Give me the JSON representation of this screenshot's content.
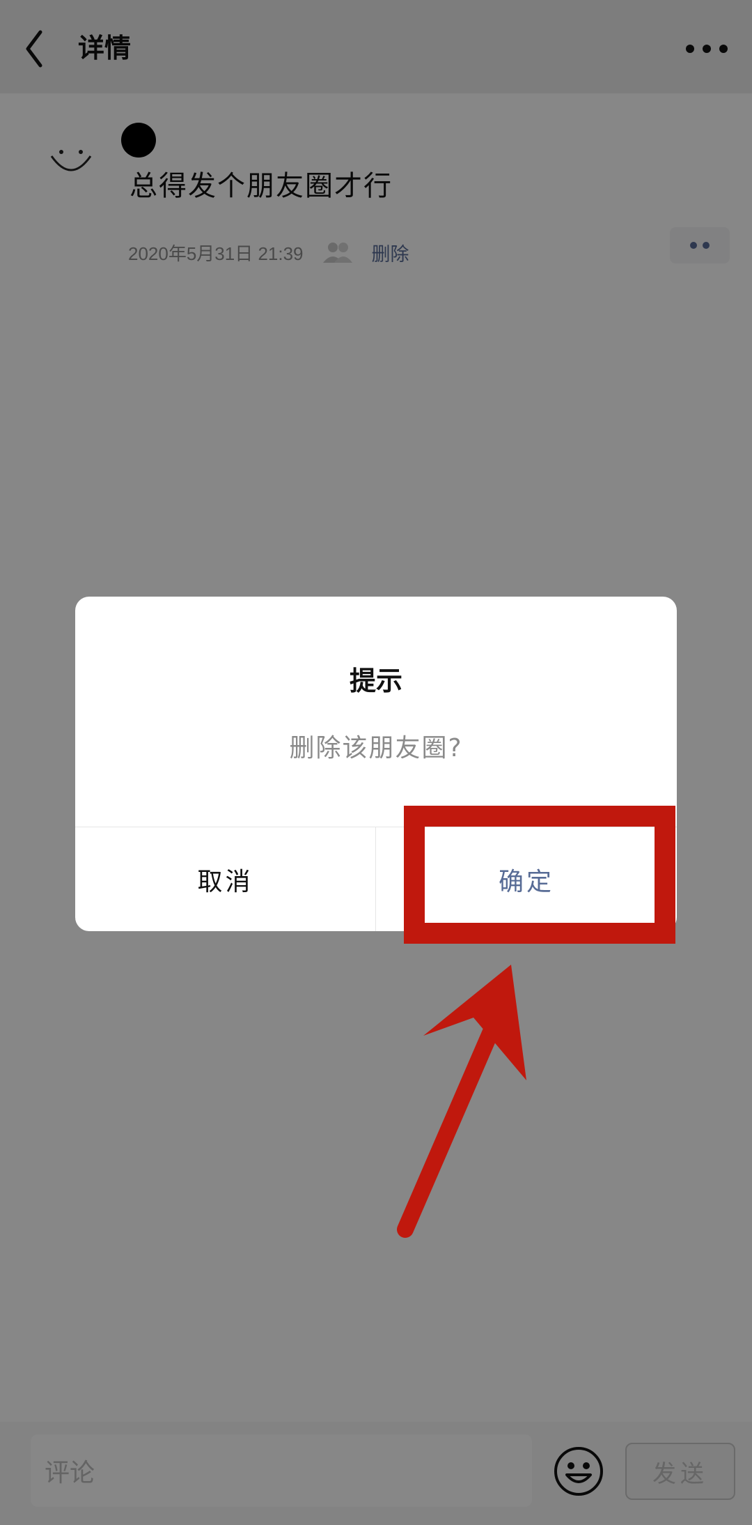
{
  "header": {
    "title": "详情"
  },
  "post": {
    "text": "总得发个朋友圈才行",
    "time": "2020年5月31日  21:39",
    "delete_label": "删除"
  },
  "comment_bar": {
    "placeholder": "评论",
    "send_label": "发送"
  },
  "dialog": {
    "title": "提示",
    "message": "删除该朋友圈?",
    "cancel_label": "取消",
    "confirm_label": "确定"
  },
  "colors": {
    "link": "#576b95",
    "annotation": "#c0180d"
  },
  "icons": {
    "back": "chevron-left-icon",
    "more": "more-horizontal-icon",
    "avatar": "smiley-avatar-icon",
    "friends": "friends-visibility-icon",
    "action": "more-actions-icon",
    "emoji": "emoji-icon"
  }
}
